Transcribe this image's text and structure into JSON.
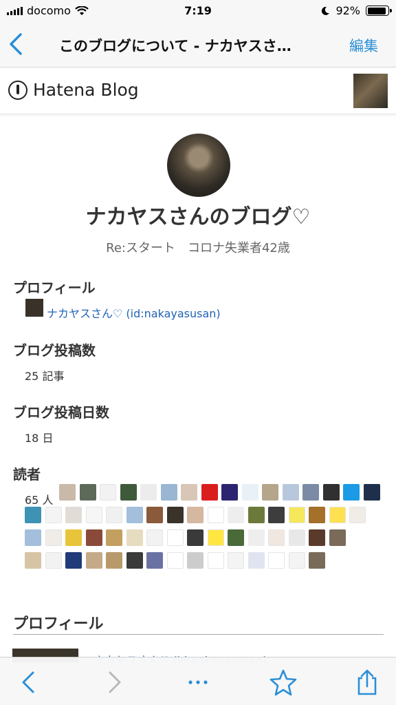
{
  "status_bar": {
    "carrier": "docomo",
    "time": "7:19",
    "battery": "92%",
    "battery_level": 0.92
  },
  "nav": {
    "title": "このブログについて - ナカヤスさ…",
    "edit_label": "編集"
  },
  "header": {
    "logo_text": "Hatena Blog"
  },
  "blog": {
    "title": "ナカヤスさんのブログ♡",
    "description": "Re:スタート　コロナ失業者42歳"
  },
  "profile": {
    "heading": "プロフィール",
    "user_link": "ナカヤスさん♡ (id:nakayasusan)"
  },
  "posts": {
    "heading": "ブログ投稿数",
    "value": "25 記事"
  },
  "days": {
    "heading": "ブログ投稿日数",
    "value": "18 日"
  },
  "readers": {
    "heading": "読者",
    "count": "65 人",
    "icon_colors": [
      "#c9b9a8",
      "#5d6a5a",
      "#f2f2f2",
      "#3f5a3a",
      "#ececec",
      "#9ab6d2",
      "#d8c6b6",
      "#d91e1e",
      "#2c2470",
      "#e9f1f7",
      "#b5a58a",
      "#b8c8dc",
      "#7b8ba5",
      "#303030",
      "#1b9ae6",
      "#1d2f4a",
      "#3e93b5",
      "#f4f4f4",
      "#e2dcd6",
      "#f6f6f6",
      "#f0f0f0",
      "#a3bfdc",
      "#8a5a3a",
      "#3a332a",
      "#d4b8a0",
      "#ffffff",
      "#eeeeee",
      "#6b7a3a",
      "#3d3d3d",
      "#f5e85a",
      "#a4702a",
      "#ffe050",
      "#f2ece6",
      "#a3bfdc",
      "#f0ece8",
      "#e8c43a",
      "#8a4a3a",
      "#c4a060",
      "#e6dcc0",
      "#f2f2f2",
      "#ffffff",
      "#3a3a3a",
      "#ffe640",
      "#4a6a3a",
      "#eeeeee",
      "#f0e8e0",
      "#e8e8e8",
      "#5a3a2a",
      "#7a6a5a",
      "#d6c4a4",
      "#f2f2f2",
      "#203a7a",
      "#c4aa88",
      "#b89a6a",
      "#3a3a3a",
      "#6a72a4",
      "#ffffff",
      "#cccccc",
      "#ffffff",
      "#f4f4f4",
      "#e0e4f0",
      "#ffffff",
      "#f4f4f4",
      "#7a6a5a"
    ]
  },
  "bottom": {
    "profile_heading": "プロフィール",
    "peek_link": "ナカヤスさん♡ (id:nakayasusan)"
  }
}
